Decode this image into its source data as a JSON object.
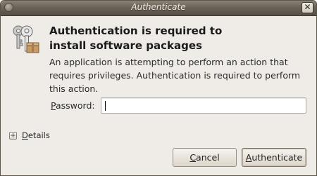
{
  "window": {
    "title": "Authenticate",
    "close_glyph": "✕",
    "menu_icon": "window-menu-icon",
    "close_icon": "close-icon"
  },
  "dialog": {
    "icon": "keys-icon",
    "heading": "Authentication is required to install software packages",
    "message": "An application is attempting to perform an action that requires privileges. Authentication is required to perform this action."
  },
  "password": {
    "label_mnemonic": "P",
    "label_rest": "assword:",
    "value": "",
    "placeholder": ""
  },
  "details": {
    "expander_glyph": "+",
    "label_mnemonic": "D",
    "label_rest": "etails"
  },
  "buttons": {
    "cancel_mnemonic": "C",
    "cancel_rest": "ancel",
    "auth_mnemonic": "A",
    "auth_rest": "uthenticate"
  },
  "colors": {
    "titlebar": "#6a6358",
    "window_bg": "#efebe7",
    "button_border": "#998f81"
  }
}
